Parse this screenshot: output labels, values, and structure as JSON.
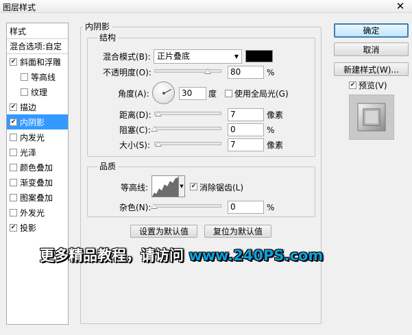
{
  "window": {
    "title": "图层样式",
    "close": "✕"
  },
  "styles_list": {
    "header": "样式",
    "blend_options": "混合选项:自定",
    "items": [
      {
        "label": "斜面和浮雕",
        "checked": true
      },
      {
        "label": "等高线",
        "checked": false
      },
      {
        "label": "纹理",
        "checked": false
      },
      {
        "label": "描边",
        "checked": true
      },
      {
        "label": "内阴影",
        "checked": true,
        "selected": true
      },
      {
        "label": "内发光",
        "checked": false
      },
      {
        "label": "光泽",
        "checked": false
      },
      {
        "label": "颜色叠加",
        "checked": false
      },
      {
        "label": "渐变叠加",
        "checked": false
      },
      {
        "label": "图案叠加",
        "checked": false
      },
      {
        "label": "外发光",
        "checked": false
      },
      {
        "label": "投影",
        "checked": true
      }
    ]
  },
  "panel": {
    "title": "内阴影",
    "structure": {
      "title": "结构",
      "blend_mode_label": "混合模式(B):",
      "blend_mode_value": "正片叠底",
      "color": "#000000",
      "opacity_label": "不透明度(O):",
      "opacity_value": "80",
      "opacity_level": 80,
      "opacity_unit": "%",
      "angle_label": "角度(A):",
      "angle_value": "30",
      "angle_unit": "度",
      "global_light_label": "使用全局光(G)",
      "global_light_checked": false,
      "distance_label": "距离(D):",
      "distance_value": "7",
      "distance_unit": "像素",
      "choke_label": "阻塞(C):",
      "choke_value": "0",
      "choke_unit": "%",
      "size_label": "大小(S):",
      "size_value": "7",
      "size_unit": "像素"
    },
    "quality": {
      "title": "品质",
      "contour_label": "等高线:",
      "antialias_label": "消除锯齿(L)",
      "antialias_checked": true,
      "noise_label": "杂色(N):",
      "noise_value": "0",
      "noise_unit": "%"
    },
    "buttons": {
      "make_default": "设置为默认值",
      "reset_default": "复位为默认值"
    }
  },
  "side_buttons": {
    "ok": "确定",
    "cancel": "取消",
    "new_style": "新建样式(W)...",
    "preview_label": "预览(V)",
    "preview_checked": true
  },
  "watermark": {
    "text": "更多精品教程，请访问 ",
    "url": "www.240PS.com"
  }
}
